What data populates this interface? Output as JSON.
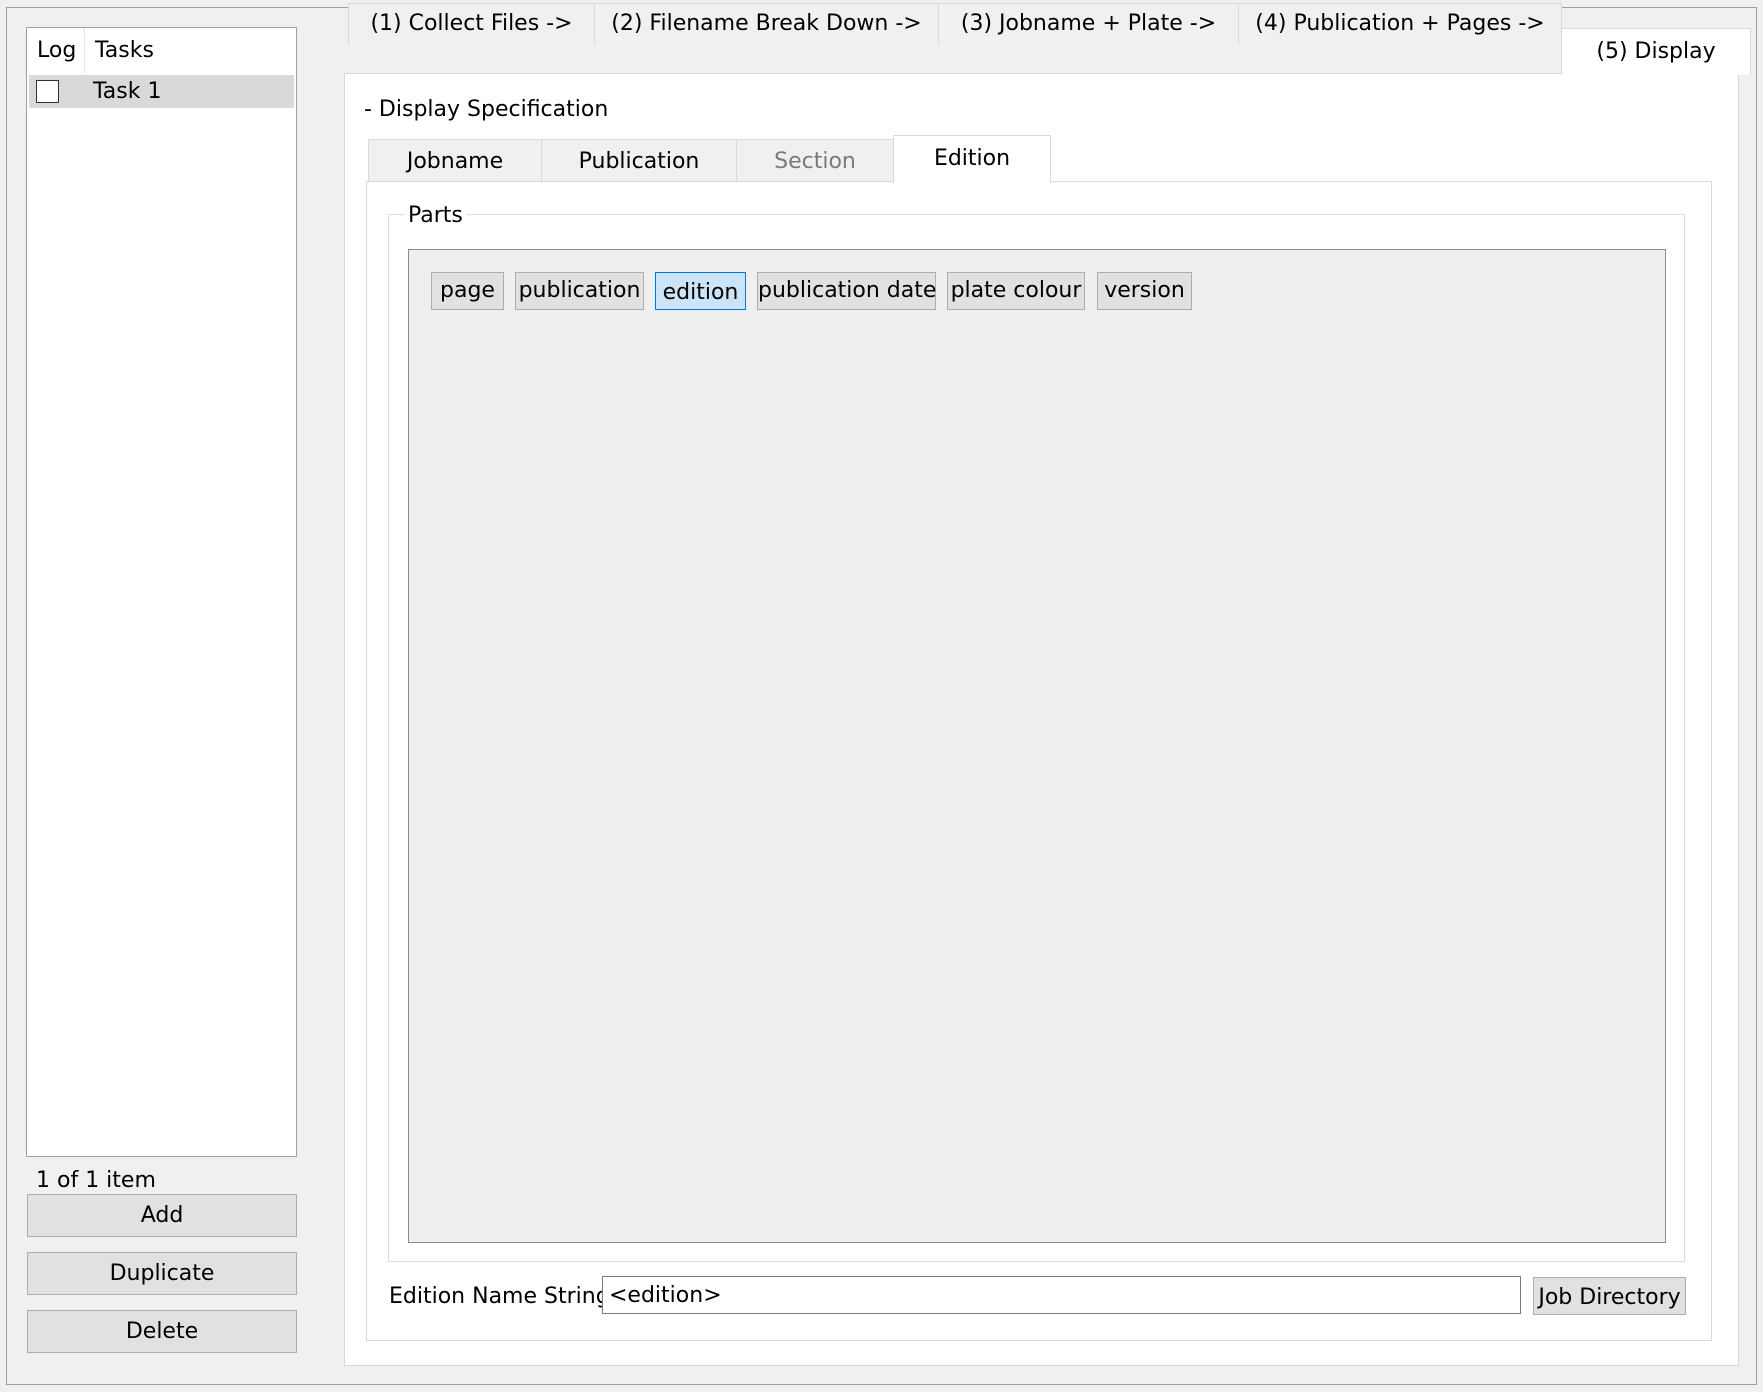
{
  "task_panel": {
    "col_log": "Log",
    "col_tasks": "Tasks",
    "rows": [
      {
        "label": "Task 1",
        "checked": false
      }
    ],
    "item_count": "1 of 1 item",
    "buttons": {
      "add": "Add",
      "duplicate": "Duplicate",
      "delete": "Delete"
    }
  },
  "main_tabs": [
    {
      "label": "(1) Collect Files ->"
    },
    {
      "label": "(2) Filename Break Down ->"
    },
    {
      "label": "(3) Jobname + Plate ->"
    },
    {
      "label": "(4) Publication + Pages ->"
    },
    {
      "label": "(5) Display",
      "active": true
    }
  ],
  "display": {
    "title": "- Display Specification",
    "tabs": [
      {
        "label": "Jobname"
      },
      {
        "label": "Publication"
      },
      {
        "label": "Section",
        "disabled": true
      },
      {
        "label": "Edition",
        "active": true
      }
    ],
    "parts_label": "Parts",
    "parts": [
      {
        "label": "page"
      },
      {
        "label": "publication"
      },
      {
        "label": "edition",
        "selected": true
      },
      {
        "label": "publication date"
      },
      {
        "label": "plate colour"
      },
      {
        "label": "version"
      }
    ],
    "name_string_label": "Edition Name String:",
    "name_string_value": "<edition>",
    "job_directory_label": "Job Directory"
  },
  "colors": {
    "selected_chip_bg": "#cce4f7",
    "selected_chip_border": "#0078d7",
    "task_row_selected": "#d9d9d9"
  }
}
